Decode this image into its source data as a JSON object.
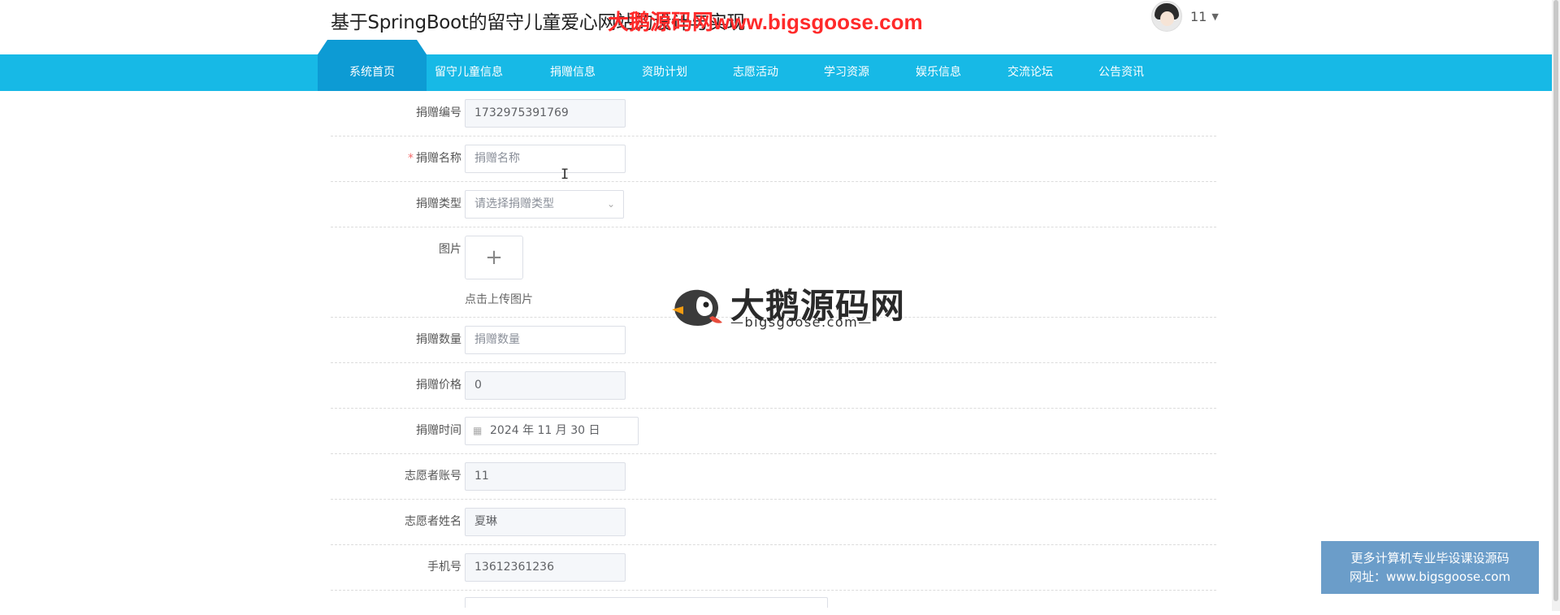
{
  "header": {
    "site_title": "基于SpringBoot的留守儿童爱心网站的设计与实现",
    "watermark": "大鹅源码网www.bigsgoose.com",
    "username": "11"
  },
  "nav": {
    "home": "系统首页",
    "items": [
      "留守儿童信息",
      "捐赠信息",
      "资助计划",
      "志愿活动",
      "学习资源",
      "娱乐信息",
      "交流论坛",
      "公告资讯"
    ]
  },
  "form": {
    "donation_no": {
      "label": "捐赠编号",
      "value": "1732975391769"
    },
    "donation_name": {
      "label": "捐赠名称",
      "required_mark": "*",
      "placeholder": "捐赠名称"
    },
    "donation_type": {
      "label": "捐赠类型",
      "placeholder": "请选择捐赠类型"
    },
    "image": {
      "label": "图片",
      "upload_hint": "点击上传图片",
      "plus": "+"
    },
    "donation_qty": {
      "label": "捐赠数量",
      "placeholder": "捐赠数量"
    },
    "donation_price": {
      "label": "捐赠价格",
      "value": "0"
    },
    "donation_time": {
      "label": "捐赠时间",
      "value": "2024 年 11 月 30 日"
    },
    "volunteer_account": {
      "label": "志愿者账号",
      "value": "11"
    },
    "volunteer_name": {
      "label": "志愿者姓名",
      "value": "夏琳"
    },
    "phone": {
      "label": "手机号",
      "value": "13612361236"
    }
  },
  "center_logo": {
    "title": "大鹅源码网",
    "subtitle": "—bigsgoose.com—"
  },
  "banner": {
    "line1": "更多计算机专业毕设课设源码",
    "line2": "网址：www.bigsgoose.com"
  },
  "colors": {
    "nav_bg": "#17b9e6",
    "nav_active": "#0d9bd4",
    "watermark": "#ff2a2a",
    "banner_bg": "#6b9dc9"
  }
}
